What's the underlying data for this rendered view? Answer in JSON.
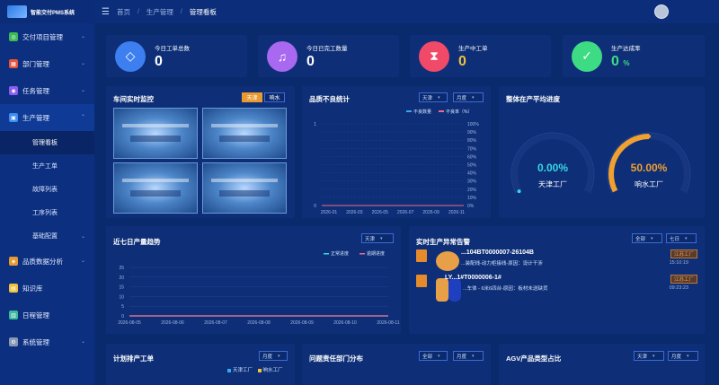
{
  "brand": {
    "title": "智能交付PMS系统"
  },
  "colors": {
    "accent": "#2c6ef2",
    "orange": "#e89a30",
    "cyan": "#34d7e8",
    "green": "#3ddc84"
  },
  "sidebar": {
    "items": [
      {
        "label": "交付项目管理",
        "icon": "delivery-icon",
        "color": "#3cba54"
      },
      {
        "label": "部门管理",
        "icon": "department-icon",
        "color": "#e8533c"
      },
      {
        "label": "任务管理",
        "icon": "task-icon",
        "color": "#8a5cf0"
      },
      {
        "label": "生产管理",
        "icon": "production-icon",
        "color": "#3d8ef0"
      },
      {
        "label": "品质数据分析",
        "icon": "quality-icon",
        "color": "#e89a30"
      },
      {
        "label": "知识库",
        "icon": "knowledge-icon",
        "color": "#f0c23c"
      },
      {
        "label": "日程管理",
        "icon": "calendar-icon",
        "color": "#3cba9a"
      },
      {
        "label": "系统管理",
        "icon": "system-icon",
        "color": "#8a98b8"
      }
    ],
    "sub": [
      "管理看板",
      "生产工单",
      "故障列表",
      "工序列表",
      "基础配置"
    ]
  },
  "breadcrumb": {
    "home": "首页",
    "section": "生产管理",
    "current": "管理看板"
  },
  "stats": [
    {
      "label": "今日工单总数",
      "value": "0",
      "icon": "diamond-icon",
      "color": "#3d7ef0"
    },
    {
      "label": "今日已完工数量",
      "value": "0",
      "icon": "headphones-icon",
      "color": "#a868f0"
    },
    {
      "label": "生产中工单",
      "value": "0",
      "icon": "hourglass-icon",
      "color": "#f04a68"
    },
    {
      "label": "生产达成率",
      "value": "0",
      "unit": "%",
      "icon": "check-icon",
      "color": "#3ddc84"
    }
  ],
  "monitor": {
    "title": "车间实时监控",
    "btn1": "天津",
    "btn2": "响水"
  },
  "defects": {
    "title": "品质不良统计",
    "sel1": "天津",
    "sel2": "月度",
    "legend1": "不良数量",
    "legend2": "不良率（%）"
  },
  "progress": {
    "title": "整体在产平均进度",
    "g1_val": "0.00%",
    "g1_label": "天津工厂",
    "g1_frac": 0,
    "g2_val": "50.00%",
    "g2_label": "响水工厂",
    "g2_frac": 0.5
  },
  "trend": {
    "title": "近七日产量趋势",
    "sel": "天津",
    "legend1": "正常进度",
    "legend2": "逾期进度"
  },
  "alerts": {
    "title": "实时生产异常告警",
    "sel1": "全部",
    "sel2": "七日",
    "items": [
      {
        "code": "...104BT0000007-26104B",
        "desc": "...装配线-动力柜接线-原因：设计干涉",
        "tag": "江苏工厂",
        "time": "15:10:19"
      },
      {
        "code": "LY...1#T0000006-1#",
        "desc": "...车体 - 6米6四台-原因：板材未送缺货",
        "tag": "江苏工厂",
        "time": "09:23:23"
      }
    ]
  },
  "bottom": {
    "p1": {
      "title": "计划排产工单",
      "sel": "月度",
      "legend1": "天津工厂",
      "legend2": "响水工厂"
    },
    "p2": {
      "title": "问题责任部门分布",
      "sel1": "全部",
      "sel2": "月度"
    },
    "p3": {
      "title": "AGV产品类型占比",
      "sel1": "天津",
      "sel2": "月度"
    }
  },
  "chart_data": [
    {
      "type": "bar",
      "title": "品质不良统计",
      "categories": [
        "2026-01",
        "2026-03",
        "2026-05",
        "2026-07",
        "2026-09",
        "2026-11"
      ],
      "ylim": [
        0,
        1
      ],
      "y2lim": [
        0,
        100
      ],
      "y_ticks": [
        "0",
        "1"
      ],
      "y2_ticks": [
        "0%",
        "10%",
        "20%",
        "30%",
        "40%",
        "50%",
        "60%",
        "70%",
        "80%",
        "90%",
        "100%"
      ],
      "series": [
        {
          "name": "不良数量",
          "values": [
            0,
            0,
            0,
            0,
            0,
            0
          ]
        },
        {
          "name": "不良率（%）",
          "values": [
            0,
            0,
            0,
            0,
            0,
            0
          ]
        }
      ]
    },
    {
      "type": "line",
      "title": "近七日产量趋势",
      "categories": [
        "2026-08-05",
        "2026-08-06",
        "2026-08-07",
        "2026-08-08",
        "2026-08-09",
        "2026-08-10",
        "2026-08-11"
      ],
      "ylim": [
        0,
        25
      ],
      "y_ticks": [
        "0",
        "5",
        "10",
        "15",
        "20",
        "25"
      ],
      "series": [
        {
          "name": "正常进度",
          "values": [
            0,
            0,
            0,
            0,
            0,
            0,
            0
          ]
        },
        {
          "name": "逾期进度",
          "values": [
            0,
            0,
            0,
            0,
            0,
            0,
            0
          ]
        }
      ]
    }
  ]
}
